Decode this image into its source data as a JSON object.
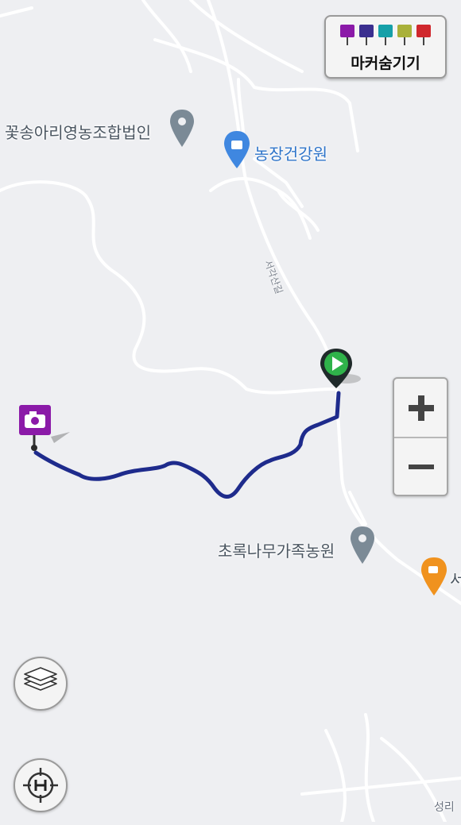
{
  "map": {
    "pois": [
      {
        "name": "꽃송아리영농조합법인",
        "icon": "map-pin-icon"
      },
      {
        "name": "농장건강원",
        "icon": "shopping-bag-pin-icon"
      },
      {
        "name": "초록나무가족농원",
        "icon": "map-pin-icon"
      },
      {
        "name": "서",
        "icon": "cafe-pin-icon"
      },
      {
        "name": "성리",
        "icon": ""
      }
    ],
    "road_name": "서각산길"
  },
  "marker_toggle": {
    "label": "마커숨기기",
    "icons": [
      {
        "name": "camera-icon",
        "color": "#8b1aa8"
      },
      {
        "name": "video-icon",
        "color": "#3b2f8f"
      },
      {
        "name": "microphone-icon",
        "color": "#16a0a8"
      },
      {
        "name": "memo-icon",
        "color": "#a9b13a"
      },
      {
        "name": "flag-icon",
        "color": "#d0282d"
      }
    ]
  },
  "route": {
    "color": "#1e2b8c",
    "start_icon": "play-icon",
    "end_icon": "camera-icon"
  },
  "controls": {
    "zoom_in": "+",
    "zoom_out": "−",
    "layers_icon": "layers-icon",
    "home_icon": "crosshair-h-icon"
  }
}
